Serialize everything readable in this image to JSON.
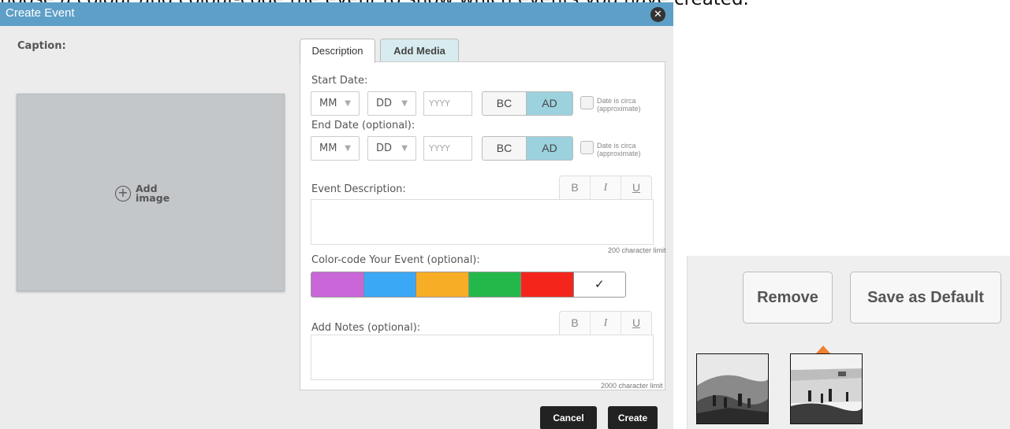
{
  "instruction_text": "hoose a colour and colour-code the event to show which events you have created.",
  "dialog": {
    "title": "Create Event",
    "close_glyph": "✕",
    "caption_label": "Caption:",
    "add_image_label": "Add image"
  },
  "tabs": [
    {
      "label": "Description",
      "active": true
    },
    {
      "label": "Add Media",
      "active": false
    }
  ],
  "form": {
    "start_date_label": "Start Date:",
    "end_date_label": "End Date (optional):",
    "month_value": "MM",
    "day_value": "DD",
    "year_placeholder": "YYYY",
    "era_bc": "BC",
    "era_ad": "AD",
    "era_selected": "AD",
    "circa_label": "Date is circa (approximate)",
    "event_description_label": "Event Description:",
    "description_limit": "200 character limit",
    "color_label": "Color-code Your Event (optional):",
    "color_selected_glyph": "✓",
    "notes_label": "Add Notes (optional):",
    "notes_limit": "2000 character limit",
    "format_bold": "B",
    "format_italic": "I",
    "format_underline": "U"
  },
  "colors": {
    "swatches": [
      "#c966d8",
      "#3aa8f5",
      "#f8ad26",
      "#24b84a",
      "#f4261b",
      "#ffffff"
    ],
    "titlebar": "#5d9fc7",
    "era_selected": "#9bd2dd",
    "marker": "#f08030"
  },
  "actions": {
    "cancel_label": "Cancel",
    "create_label": "Create"
  },
  "side_panel": {
    "remove_label": "Remove",
    "save_default_label": "Save as Default"
  }
}
